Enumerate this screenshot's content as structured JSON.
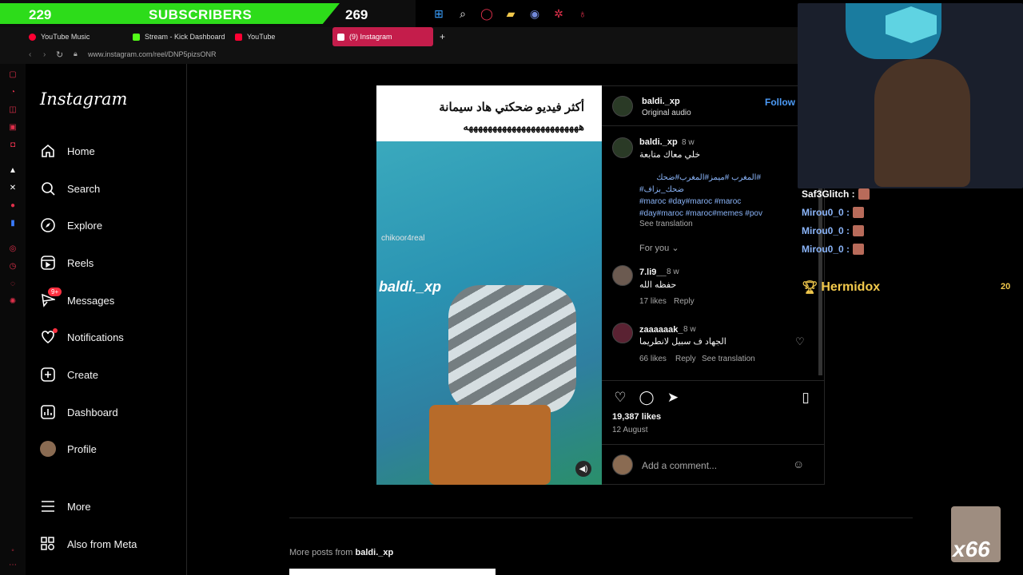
{
  "overlay": {
    "sub_count": "229",
    "sub_label": "SUBSCRIBERS",
    "sub_goal": "269"
  },
  "tabs": [
    {
      "label": "YouTube Music",
      "color": "#ff0033"
    },
    {
      "label": "Stream - Kick Dashboard",
      "color": "#53fc18"
    },
    {
      "label": "YouTube",
      "color": "#ff0033"
    },
    {
      "label": "(9) Instagram",
      "color": "#c41d4b"
    }
  ],
  "url": "www.instagram.com/reel/DNP5pizsONR",
  "sidebar": {
    "logo": "Instagram",
    "items": [
      {
        "label": "Home",
        "icon": "home-icon"
      },
      {
        "label": "Search",
        "icon": "search-icon"
      },
      {
        "label": "Explore",
        "icon": "compass-icon"
      },
      {
        "label": "Reels",
        "icon": "reels-icon"
      },
      {
        "label": "Messages",
        "icon": "messenger-icon"
      },
      {
        "label": "Notifications",
        "icon": "heart-icon"
      },
      {
        "label": "Create",
        "icon": "plus-icon"
      },
      {
        "label": "Dashboard",
        "icon": "dashboard-icon"
      },
      {
        "label": "Profile",
        "icon": "avatar"
      },
      {
        "label": "More",
        "icon": "menu-icon"
      },
      {
        "label": "Also from Meta",
        "icon": "meta-icon"
      }
    ],
    "messages_badge": "9+"
  },
  "post": {
    "caption_line1": "أكثر فيديو ضحكتي هاد سيمانة",
    "caption_line2": "ههههههههههههههههههههههههه",
    "watermark_small": "chikoor4real",
    "watermark_large": "baldi._xp",
    "author": "baldi._xp",
    "audio": "Original audio",
    "follow": "Follow",
    "desc_user": "baldi._xp",
    "desc_time": "8 w",
    "desc_text": "خلي معاك متابعة",
    "hashtags": [
      "#المغرب #ميمز#المغرب#ضحك",
      "#ضحك_بزاف",
      "#maroc #day#maroc #maroc",
      "#day#maroc #maroc#memes #pov"
    ],
    "see_translation": "See translation",
    "for_you": "For you",
    "comments": [
      {
        "user": "7.li9__",
        "time": "8 w",
        "text": "حفظه الله",
        "likes": "17 likes",
        "reply": "Reply"
      },
      {
        "user": "zaaaaaak_",
        "time": "8 w",
        "text": "الجهاد ف سبيل لانطريما",
        "likes": "66 likes",
        "reply": "Reply",
        "translate": "See translation"
      }
    ],
    "likes": "19,387 likes",
    "date": "12 August",
    "comment_placeholder": "Add a comment..."
  },
  "chat": [
    {
      "user": "Saf3Glitch :",
      "color": "#ffffff"
    },
    {
      "user": "Mirou0_0 :",
      "color": "#8ab4f8"
    },
    {
      "user": "Mirou0_0 :",
      "color": "#8ab4f8"
    },
    {
      "user": "Mirou0_0 :",
      "color": "#8ab4f8"
    }
  ],
  "leader": {
    "name": "Hermidox",
    "value": "20"
  },
  "more_posts": {
    "label": "More posts from",
    "user": "baldi._xp"
  },
  "combo": "x66"
}
